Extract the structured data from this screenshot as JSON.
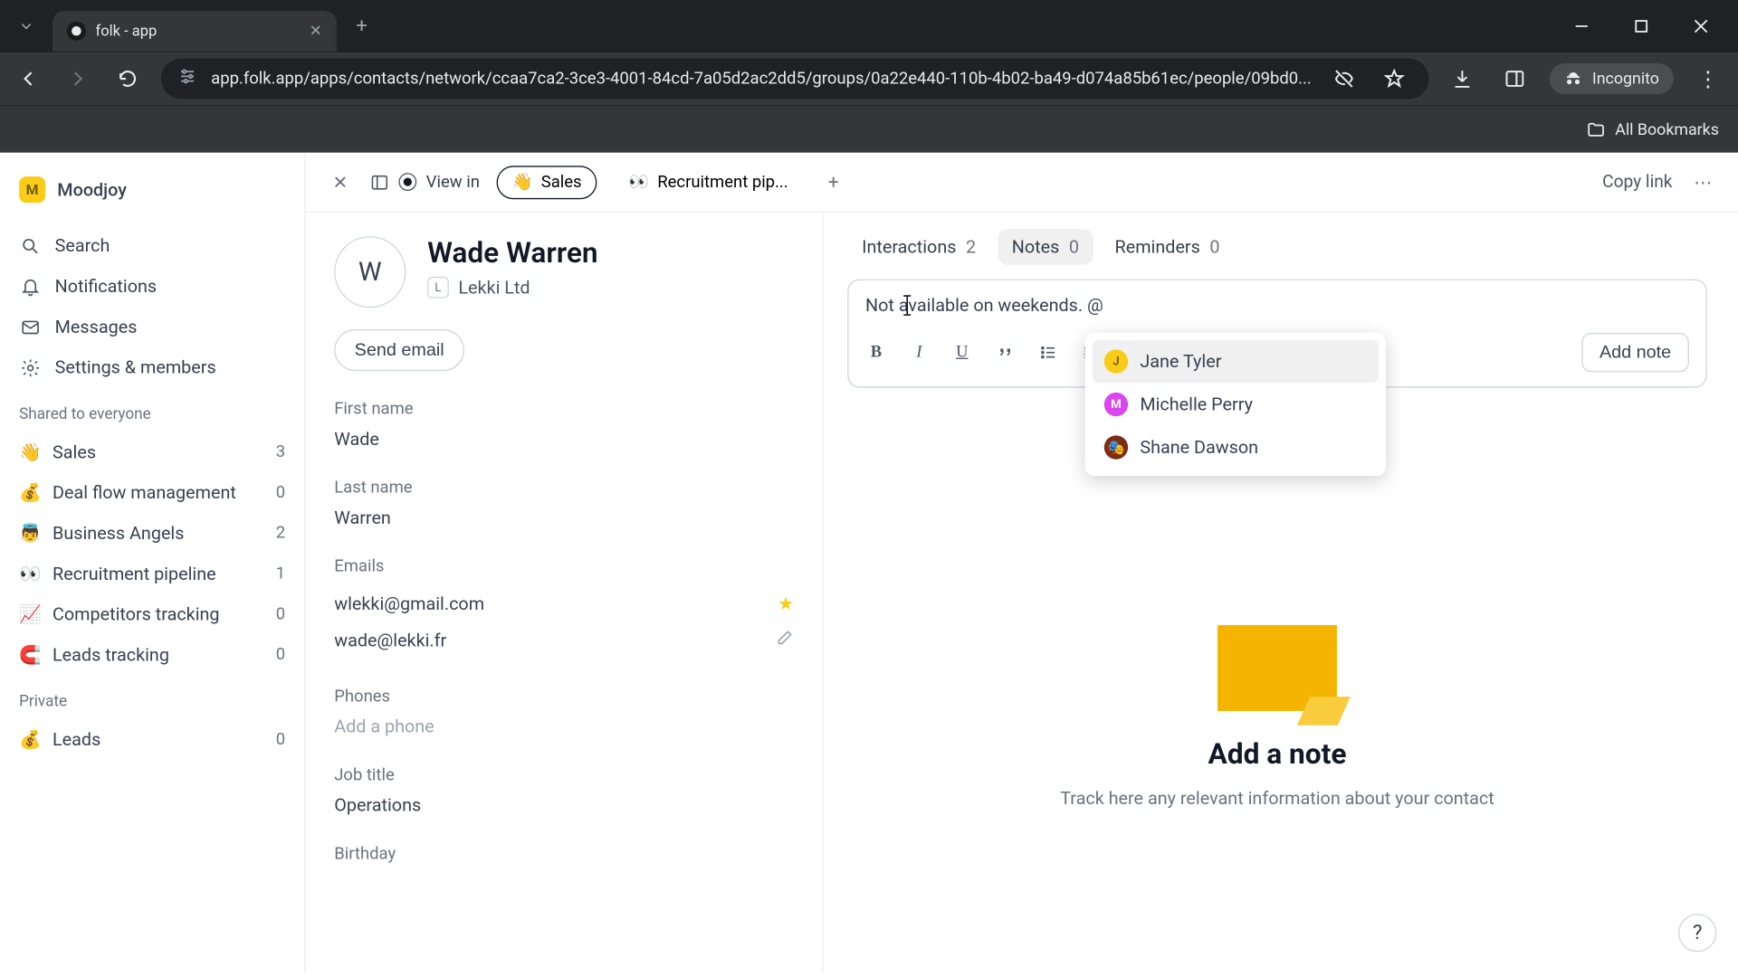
{
  "browser": {
    "tab_title": "folk - app",
    "url": "app.folk.app/apps/contacts/network/ccaa7ca2-3ce3-4001-84cd-7a05d2ac2dd5/groups/0a22e440-110b-4b02-ba49-d074a85b61ec/people/09bd0...",
    "incognito": "Incognito",
    "all_bookmarks": "All Bookmarks"
  },
  "sidebar": {
    "workspace": "Moodjoy",
    "workspace_initial": "M",
    "nav": {
      "search": "Search",
      "notifications": "Notifications",
      "messages": "Messages",
      "settings": "Settings & members"
    },
    "shared_label": "Shared to everyone",
    "private_label": "Private",
    "groups": [
      {
        "emoji": "👋",
        "name": "Sales",
        "count": "3"
      },
      {
        "emoji": "💰",
        "name": "Deal flow management",
        "count": "0"
      },
      {
        "emoji": "👼",
        "name": "Business Angels",
        "count": "2"
      },
      {
        "emoji": "👀",
        "name": "Recruitment pipeline",
        "count": "1"
      },
      {
        "emoji": "📈",
        "name": "Competitors tracking",
        "count": "0"
      },
      {
        "emoji": "🧲",
        "name": "Leads tracking",
        "count": "0"
      }
    ],
    "private_groups": [
      {
        "emoji": "💰",
        "name": "Leads",
        "count": "0"
      }
    ]
  },
  "topbar": {
    "view_in": "View in",
    "pills": [
      {
        "emoji": "👋",
        "label": "Sales",
        "active": true
      },
      {
        "emoji": "👀",
        "label": "Recruitment pip...",
        "active": false
      }
    ],
    "copy_link": "Copy link"
  },
  "contact": {
    "avatar_initial": "W",
    "name": "Wade Warren",
    "company_initial": "L",
    "company": "Lekki Ltd",
    "send_email": "Send email",
    "fields": {
      "first_name_label": "First name",
      "first_name": "Wade",
      "last_name_label": "Last name",
      "last_name": "Warren",
      "emails_label": "Emails",
      "emails": [
        {
          "value": "wlekki@gmail.com",
          "primary": true
        },
        {
          "value": "wade@lekki.fr",
          "primary": false
        }
      ],
      "phones_label": "Phones",
      "phones_placeholder": "Add a phone",
      "job_label": "Job title",
      "job": "Operations",
      "birthday_label": "Birthday"
    }
  },
  "right": {
    "tabs": [
      {
        "label": "Interactions",
        "count": "2",
        "active": false
      },
      {
        "label": "Notes",
        "count": "0",
        "active": true
      },
      {
        "label": "Reminders",
        "count": "0",
        "active": false
      }
    ],
    "note_text": "Not available on weekends. @",
    "add_note": "Add note",
    "mentions": [
      {
        "initial": "J",
        "name": "Jane Tyler",
        "color": "#facc15",
        "text": "#715b05",
        "hl": true
      },
      {
        "initial": "M",
        "name": "Michelle Perry",
        "color": "#d946ef",
        "text": "#fff",
        "hl": false
      },
      {
        "initial": "",
        "name": "Shane Dawson",
        "color": "#7c2d12",
        "text": "#fff",
        "hl": false,
        "emoji": "🎭"
      }
    ],
    "empty_title": "Add a note",
    "empty_sub": "Track here any relevant information about your contact"
  }
}
